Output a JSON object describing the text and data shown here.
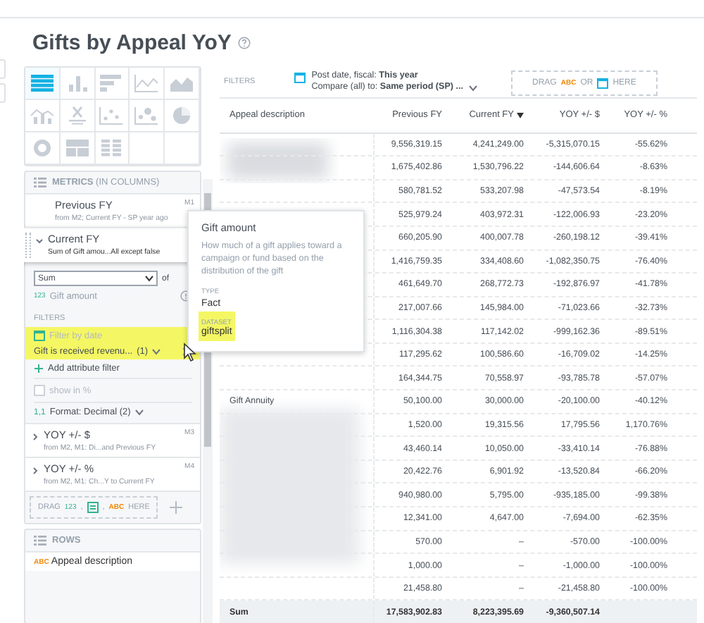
{
  "header": {
    "title": "Gifts by Appeal YoY"
  },
  "viz_types": [
    {
      "kind": "table",
      "selected": true
    },
    {
      "kind": "column",
      "selected": false
    },
    {
      "kind": "bar",
      "selected": false
    },
    {
      "kind": "line",
      "selected": false
    },
    {
      "kind": "area",
      "selected": false
    },
    {
      "kind": "combo",
      "selected": false
    },
    {
      "kind": "headline",
      "selected": false
    },
    {
      "kind": "scatter",
      "selected": false
    },
    {
      "kind": "bubble",
      "selected": false
    },
    {
      "kind": "pie",
      "selected": false
    },
    {
      "kind": "donut",
      "selected": false
    },
    {
      "kind": "treemap",
      "selected": false
    },
    {
      "kind": "heatmap",
      "selected": false
    },
    {
      "kind": "empty"
    },
    {
      "kind": "empty"
    }
  ],
  "metrics": {
    "heading": "METRICS",
    "heading_note": "(IN COLUMNS)",
    "items": [
      {
        "name": "Previous FY",
        "subtitle": "from M2; Current FY - SP year ago",
        "tag": "M1",
        "expanded": false
      },
      {
        "name": "Current FY",
        "subtitle": "Sum of Gift amou...All except false",
        "expanded": true
      },
      {
        "name": "YOY +/- $",
        "subtitle": "from M2, M1: Di...and Previous FY",
        "tag": "M3",
        "expanded": false
      },
      {
        "name": "YOY +/- %",
        "subtitle": "from M2, M1: Ch...Y to Current FY",
        "tag": "M4",
        "expanded": false
      }
    ]
  },
  "metric_detail": {
    "aggregation": "Sum",
    "of": "of",
    "fact_type": "123",
    "fact": "Gift amount",
    "filters_label": "FILTERS",
    "date_filter": "Filter by date",
    "attribute_filter": {
      "label": "Gift is received revenu...",
      "count": "(1)",
      "highlighted": true
    },
    "add_filter": "Add attribute filter",
    "show_percent": {
      "label": "show in %",
      "checked": false
    },
    "format_prefix": "1,1",
    "format": "Format: Decimal (2)"
  },
  "metric_drop": {
    "drag": "DRAG",
    "measure": "123",
    "sep1": ",",
    "sep2": ",",
    "attribute": "ABC",
    "here": "HERE"
  },
  "rows_section": {
    "heading": "ROWS",
    "items": [
      {
        "type": "ABC",
        "name": "Appeal description"
      }
    ]
  },
  "filter_bar": {
    "label": "FILTERS",
    "date": "Post date, fiscal: **This year**",
    "compare": "Compare (all) to: **Same period (SP) ...**",
    "drop": {
      "drag": "DRAG",
      "attribute": "ABC",
      "or": "OR",
      "here": "HERE"
    }
  },
  "table": {
    "columns": [
      {
        "label": "Appeal description",
        "sorted": false
      },
      {
        "label": "Previous FY",
        "sorted": false
      },
      {
        "label": "Current FY",
        "sorted": true
      },
      {
        "label": "YOY +/- $",
        "sorted": false
      },
      {
        "label": "YOY +/- %",
        "sorted": false
      }
    ],
    "rows": [
      {
        "values": [
          "9,556,319.15",
          "4,241,249.00",
          "-5,315,070.15",
          "-55.62%"
        ]
      },
      {
        "values": [
          "1,675,402.86",
          "1,530,796.22",
          "-144,606.64",
          "-8.63%"
        ]
      },
      {
        "values": [
          "580,781.52",
          "533,207.98",
          "-47,573.54",
          "-8.19%"
        ]
      },
      {
        "values": [
          "525,979.24",
          "403,972.31",
          "-122,006.93",
          "-23.20%"
        ]
      },
      {
        "values": [
          "660,205.90",
          "400,007.78",
          "-260,198.12",
          "-39.41%"
        ]
      },
      {
        "values": [
          "1,416,759.35",
          "334,408.60",
          "-1,082,350.75",
          "-76.40%"
        ]
      },
      {
        "values": [
          "461,649.70",
          "268,772.73",
          "-192,876.97",
          "-41.78%"
        ]
      },
      {
        "values": [
          "217,007.66",
          "145,984.00",
          "-71,023.66",
          "-32.73%"
        ]
      },
      {
        "values": [
          "1,116,304.38",
          "117,142.02",
          "-999,162.36",
          "-89.51%"
        ]
      },
      {
        "values": [
          "117,295.62",
          "100,586.60",
          "-16,709.02",
          "-14.25%"
        ]
      },
      {
        "values": [
          "164,344.75",
          "70,558.97",
          "-93,785.78",
          "-57.07%"
        ]
      },
      {
        "label": "Gift Annuity",
        "values": [
          "50,100.00",
          "30,000.00",
          "-20,100.00",
          "-40.12%"
        ]
      },
      {
        "values": [
          "1,520.00",
          "19,315.56",
          "17,795.56",
          "1,170.76%"
        ]
      },
      {
        "values": [
          "43,460.14",
          "10,050.00",
          "-33,410.14",
          "-76.88%"
        ]
      },
      {
        "values": [
          "20,422.76",
          "6,901.92",
          "-13,520.84",
          "-66.20%"
        ]
      },
      {
        "values": [
          "940,980.00",
          "5,795.00",
          "-935,185.00",
          "-99.38%"
        ]
      },
      {
        "values": [
          "12,341.00",
          "4,647.00",
          "-7,694.00",
          "-62.35%"
        ]
      },
      {
        "values": [
          "570.00",
          "–",
          "-570.00",
          "-100.00%"
        ]
      },
      {
        "values": [
          "1,000.00",
          "–",
          "-1,000.00",
          "-100.00%"
        ]
      },
      {
        "values": [
          "21,458.80",
          "–",
          "-21,458.80",
          "-100.00%"
        ]
      }
    ],
    "total": {
      "label": "Sum",
      "values": [
        "17,583,902.83",
        "8,223,395.69",
        "-9,360,507.14"
      ]
    }
  },
  "tooltip": {
    "title": "Gift amount",
    "description": "How much of a gift applies toward a campaign or fund based on the distribution of the gift",
    "type_label": "TYPE",
    "type": "Fact",
    "dataset_label": "DATASET",
    "dataset": "giftsplit",
    "dataset_highlighted": true
  }
}
